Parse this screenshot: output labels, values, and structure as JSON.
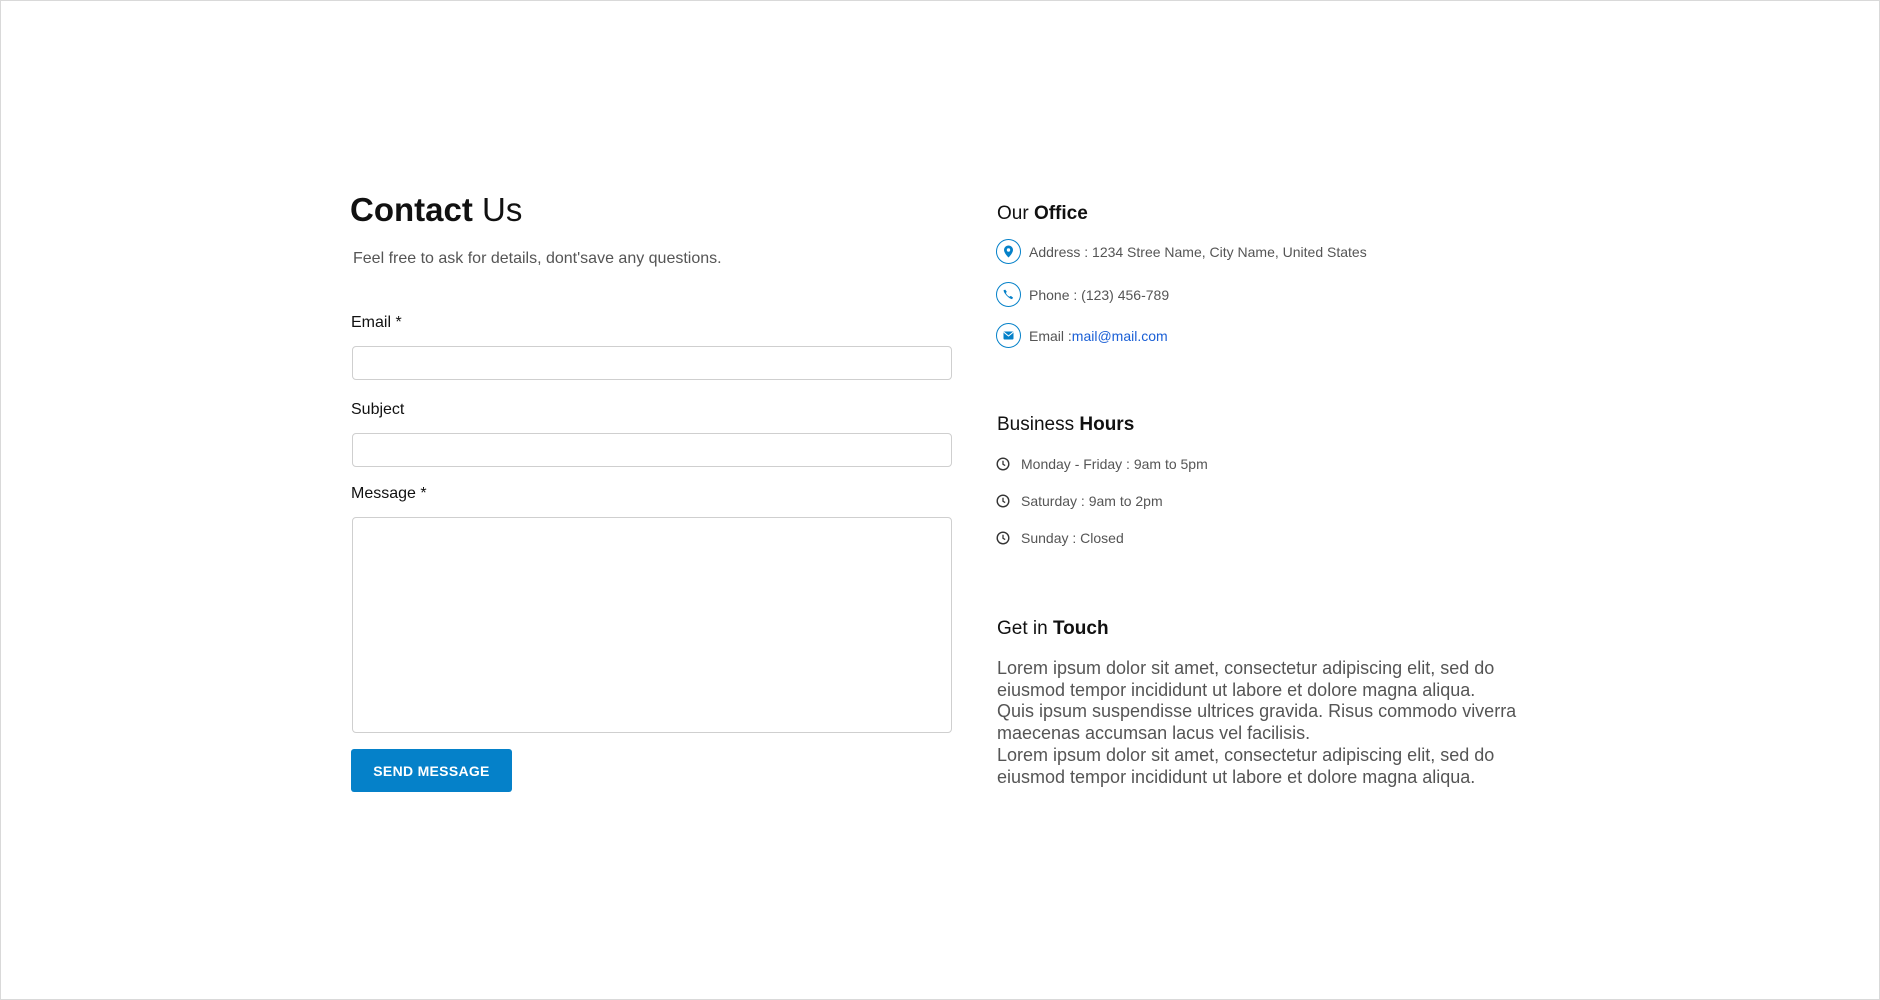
{
  "contact": {
    "title_bold": "Contact",
    "title_rest": " Us",
    "subtitle": "Feel free to ask for details, dont'save any questions.",
    "email_label": "Email *",
    "email_value": "",
    "subject_label": "Subject",
    "subject_value": "",
    "message_label": "Message *",
    "message_value": "",
    "send_label": "SEND MESSAGE"
  },
  "office": {
    "title_light": "Our ",
    "title_bold": "Office",
    "address": "Address : 1234 Stree Name, City Name, United States",
    "phone": "Phone : (123) 456-789",
    "email_prefix": "Email : ",
    "email_link": "mail@mail.com"
  },
  "hours": {
    "title_light": "Business ",
    "title_bold": "Hours",
    "items": [
      "Monday - Friday : 9am to 5pm",
      "Saturday : 9am to 2pm",
      "Sunday : Closed"
    ]
  },
  "touch": {
    "title_light": "Get in ",
    "title_bold": "Touch",
    "lines": [
      "Lorem ipsum dolor sit amet, consectetur adipiscing elit, sed do eiusmod tempor incididunt ut labore et dolore magna aliqua.",
      "Quis ipsum suspendisse ultrices gravida. Risus commodo viverra maecenas accumsan lacus vel facilisis.",
      "Lorem ipsum dolor sit amet, consectetur adipiscing elit, sed do eiusmod tempor incididunt ut labore et dolore magna aliqua."
    ]
  },
  "colors": {
    "accent": "#0581c9",
    "link": "#1a5fd6"
  }
}
